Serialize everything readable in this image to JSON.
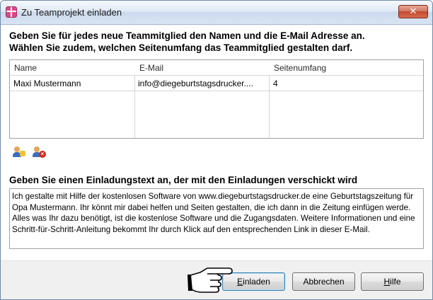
{
  "window": {
    "title": "Zu Teamprojekt einladen",
    "close_label": "✕"
  },
  "instructions": {
    "line1": "Geben Sie für jedes neue Teammitglied den Namen und die E-Mail Adresse an.",
    "line2": "Wählen Sie zudem, welchen Seitenumfang das Teammitglied gestalten darf."
  },
  "members_table": {
    "columns": [
      "Name",
      "E-Mail",
      "Seitenumfang"
    ],
    "rows": [
      [
        "Maxi Mustermann",
        "info@diegeburtstagsdrucker....",
        "4"
      ]
    ]
  },
  "table_actions": {
    "add_icon": "add-user-icon",
    "remove_icon": "remove-user-icon"
  },
  "invitation": {
    "heading": "Geben Sie einen Einladungstext an, der mit den Einladungen verschickt wird",
    "text": "Ich gestalte mit Hilfe der kostenlosen Software von www.diegeburtstagsdrucker.de eine Geburtstagszeitung für Opa Mustermann. Ihr könnt mir dabei helfen und Seiten gestalten, die ich dann in die Zeitung einfügen werde. Alles was Ihr dazu benötigt, ist die kostenlose Software und die Zugangsdaten. Weitere Informationen und eine Schritt-für-Schritt-Anleitung bekommt Ihr durch Klick auf den entsprechenden Link in dieser E-Mail."
  },
  "buttons": {
    "invite": "Einladen",
    "cancel": "Abbrechen",
    "help": "Hilfe"
  },
  "colors": {
    "title_gradient_top": "#f6f9fd",
    "close_red": "#c14a30",
    "default_button_border": "#3c7fb1"
  }
}
